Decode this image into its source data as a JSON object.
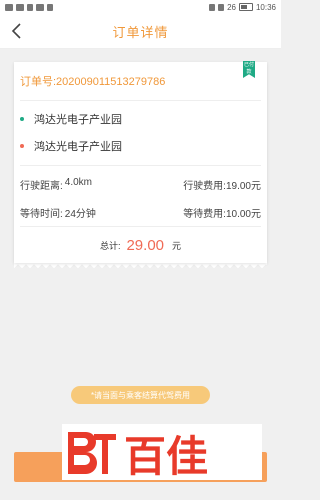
{
  "status_bar": {
    "time": "10:36",
    "battery": "26"
  },
  "nav": {
    "title": "订单详情"
  },
  "order": {
    "number_label": "订单号:20200901151327978​6",
    "ribbon_text": "已付\n款"
  },
  "route": {
    "start": "鸿达光电子产业园",
    "end": "鸿达光电子产业园"
  },
  "fees": {
    "distance_label": "行驶距离:",
    "distance_value": "4.0km",
    "drive_fee_label": "行驶费用:",
    "drive_fee_value": "19.00元",
    "wait_time_label": "等待时间:",
    "wait_time_value": "24分钟",
    "wait_fee_label": "等待费用:",
    "wait_fee_value": "10.00元"
  },
  "total": {
    "label": "总计:",
    "amount": "29.00",
    "unit": "元"
  },
  "notice": "*请当面与乘客结算代驾费用",
  "watermark_text": "百佳",
  "colors": {
    "accent": "#f0983a",
    "green": "#1faa85",
    "red": "#f06a55",
    "button": "#f6a05b"
  }
}
